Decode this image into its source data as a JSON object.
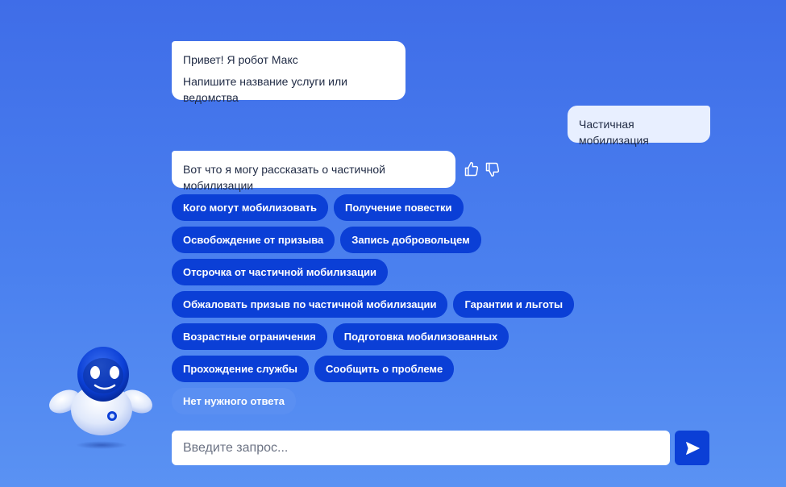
{
  "chat": {
    "greeting_lines": [
      "Привет! Я робот Макс",
      "Напишите название услуги или ведомства"
    ],
    "user_message": "Частичная мобилизация",
    "bot_intro": "Вот что я могу рассказать о частичной мобилизации"
  },
  "reactions": {
    "like_icon": "thumbs-up-icon",
    "dislike_icon": "thumbs-down-icon"
  },
  "suggestions": {
    "rows": [
      [
        "Кого могут мобилизовать",
        "Получение повестки"
      ],
      [
        "Освобождение от призыва",
        "Запись добровольцем"
      ],
      [
        "Отсрочка от частичной мобилизации"
      ],
      [
        "Обжаловать призыв по частичной мобилизации",
        "Гарантии и льготы"
      ],
      [
        "Возрастные ограничения",
        "Подготовка мобилизованных"
      ],
      [
        "Прохождение службы",
        "Сообщить о проблеме"
      ],
      [
        "Нет нужного ответа"
      ]
    ]
  },
  "input": {
    "placeholder": "Введите запрос...",
    "value": ""
  },
  "send": {
    "icon": "send-arrow-icon"
  },
  "avatar": {
    "icon": "robot-max-avatar"
  },
  "colors": {
    "background_top": "#3f6de8",
    "background_bottom": "#5a92f3",
    "chip": "#0b3fd6",
    "chip_soft": "#5a8ff2",
    "bubble_user": "#e8efff"
  }
}
